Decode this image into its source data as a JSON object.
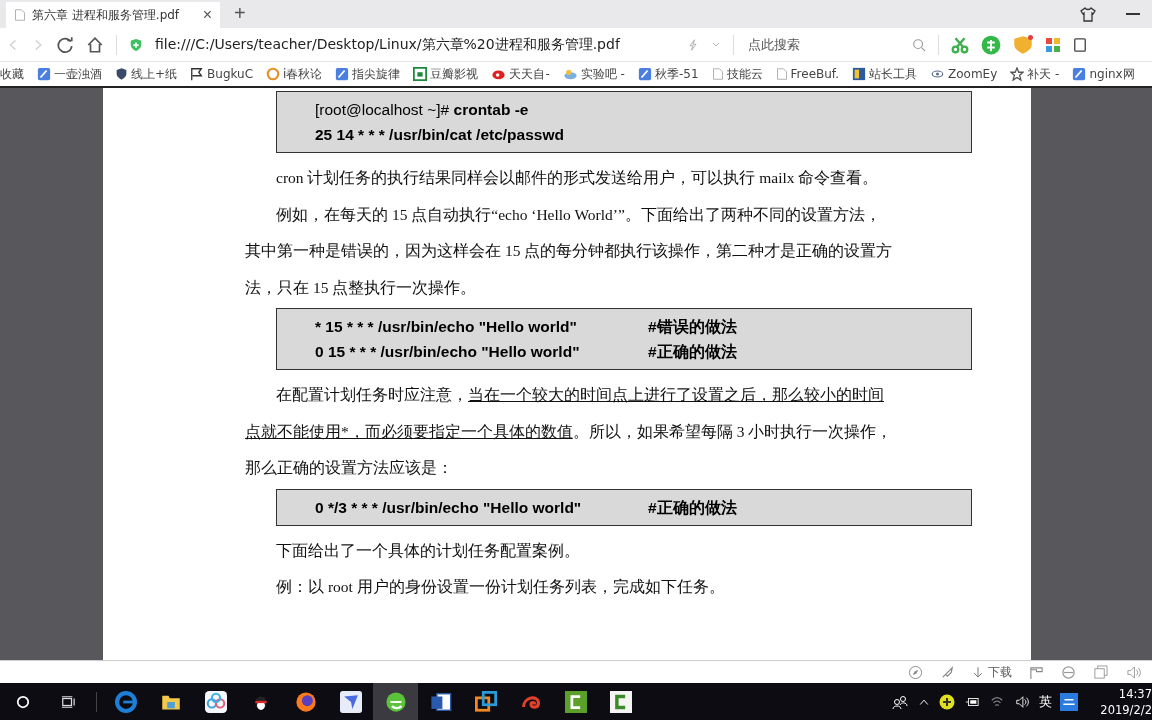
{
  "tab": {
    "title": "第六章 进程和服务管理.pdf",
    "selected": true,
    "close": "×",
    "new_tab": "+"
  },
  "address_bar": {
    "url": "file:///C:/Users/teacher/Desktop/Linux/第六章%20进程和服务管理.pdf",
    "search": {
      "placeholder": "点此搜索"
    },
    "back_disabled": true,
    "forward_disabled": true
  },
  "bookmarks": [
    {
      "label": "收藏",
      "kind": "menu"
    },
    {
      "label": "一壶浊酒",
      "kind": "feather"
    },
    {
      "label": "线上+纸",
      "kind": "shield"
    },
    {
      "label": "BugkuC",
      "kind": "flag"
    },
    {
      "label": "i春秋论",
      "kind": "orange"
    },
    {
      "label": "指尖旋律",
      "kind": "feather"
    },
    {
      "label": "豆瓣影视",
      "kind": "green"
    },
    {
      "label": "天天自-",
      "kind": "eye"
    },
    {
      "label": "实验吧 -",
      "kind": "cloud"
    },
    {
      "label": "秋季-51",
      "kind": "feather"
    },
    {
      "label": "技能云",
      "kind": "page"
    },
    {
      "label": "FreeBuf.",
      "kind": "page"
    },
    {
      "label": "站长工具",
      "kind": "tile"
    },
    {
      "label": "ZoomEy",
      "kind": "eye2"
    },
    {
      "label": "补天 -",
      "kind": "star"
    },
    {
      "label": "nginx网",
      "kind": "feather"
    }
  ],
  "document": [
    {
      "kind": "code",
      "lines": [
        {
          "prompt": "[root@localhost ~]#",
          "command": "crontab -e"
        },
        {
          "command": "25 14 * * * /usr/bin/cat /etc/passwd"
        }
      ]
    },
    {
      "kind": "paragraph",
      "segments": [
        {
          "text": "cron 计划任务的执行结果同样会以邮件的形式发送给用户，可以执行 mailx 命令查看。",
          "underline": false
        }
      ]
    },
    {
      "kind": "paragraph",
      "segments": [
        {
          "text": "例如，在每天的 15 点自动执行“echo ‘Hello World’”。下面给出了两种不同的设置方法，其中第一种是错误的，因为这样会在 15 点的每分钟都执行该操作，第二种才是正确的设置方法，只在 15 点整执行一次操作。",
          "underline": false
        }
      ]
    },
    {
      "kind": "code",
      "lines": [
        {
          "command": "* 15 * * * /usr/bin/echo \"Hello world\"",
          "comment": "#错误的做法"
        },
        {
          "command": "0 15 * * * /usr/bin/echo \"Hello world\"",
          "comment": "#正确的做法"
        }
      ]
    },
    {
      "kind": "paragraph",
      "segments": [
        {
          "text": "在配置计划任务时应注意，",
          "underline": false
        },
        {
          "text": "当在一个较大的时间点上进行了设置之后，那么较小的时间点就不能使用*，而必须要指定一个具体的数值",
          "underline": true
        },
        {
          "text": "。所以，如果希望每隔 3 小时执行一次操作，那么正确的设置方法应该是：",
          "underline": false
        }
      ]
    },
    {
      "kind": "code",
      "lines": [
        {
          "command": "0 */3 * * * /usr/bin/echo \"Hello world\"",
          "comment": "#正确的做法"
        }
      ]
    },
    {
      "kind": "paragraph",
      "segments": [
        {
          "text": "下面给出了一个具体的计划任务配置案例。",
          "underline": false
        }
      ]
    },
    {
      "kind": "paragraph",
      "segments": [
        {
          "text": "例：以 root 用户的身份设置一份计划任务列表，完成如下任务。",
          "underline": false
        }
      ]
    }
  ],
  "status_bar": {
    "download": "下载"
  },
  "taskbar": {
    "apps": [
      {
        "kind": "edge",
        "selected": false
      },
      {
        "kind": "folder",
        "selected": false
      },
      {
        "kind": "cloud",
        "selected": false
      },
      {
        "kind": "penguin",
        "selected": false
      },
      {
        "kind": "fox",
        "selected": false
      },
      {
        "kind": "bird",
        "selected": false
      },
      {
        "kind": "browser",
        "selected": true
      },
      {
        "kind": "word",
        "selected": false
      },
      {
        "kind": "boxes",
        "selected": false
      },
      {
        "kind": "snail",
        "selected": false
      },
      {
        "kind": "green-c",
        "selected": false
      },
      {
        "kind": "white-c",
        "selected": false
      }
    ],
    "ime": "英",
    "time": "14:37",
    "date": "2019/2/2"
  }
}
